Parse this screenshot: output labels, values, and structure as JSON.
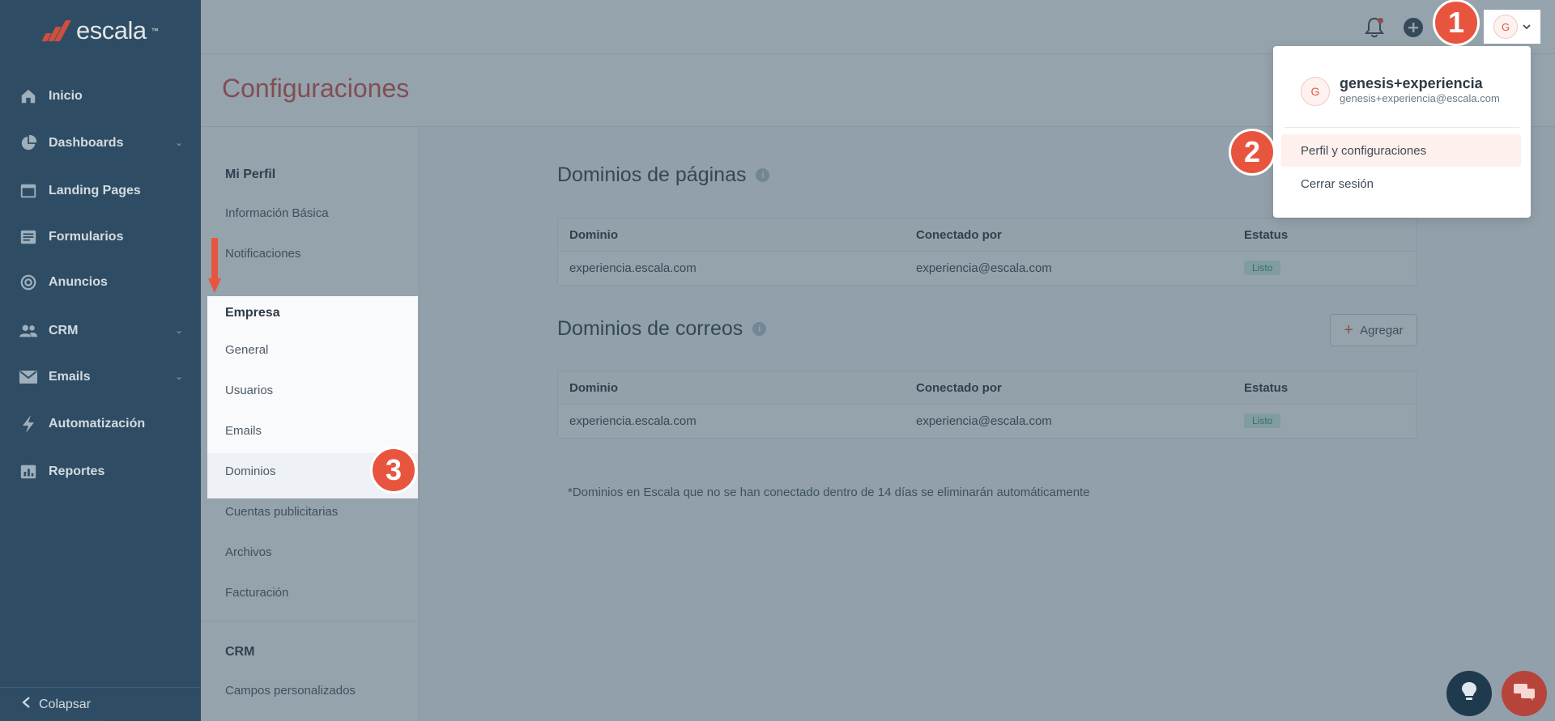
{
  "app": {
    "logo_text": "escala"
  },
  "sidebar": {
    "items": [
      {
        "label": "Inicio",
        "icon": "home-icon",
        "chevron": false
      },
      {
        "label": "Dashboards",
        "icon": "pie-chart-icon",
        "chevron": true
      },
      {
        "label": "Landing Pages",
        "icon": "browser-window-icon",
        "chevron": false
      },
      {
        "label": "Formularios",
        "icon": "form-icon",
        "chevron": false
      },
      {
        "label": "Anuncios",
        "icon": "target-icon",
        "chevron": false
      },
      {
        "label": "CRM",
        "icon": "users-icon",
        "chevron": true
      },
      {
        "label": "Emails",
        "icon": "envelope-icon",
        "chevron": true
      },
      {
        "label": "Automatización",
        "icon": "lightning-icon",
        "chevron": false
      },
      {
        "label": "Reportes",
        "icon": "bar-chart-icon",
        "chevron": false
      }
    ],
    "collapse_label": "Colapsar"
  },
  "topbar": {
    "avatar_initial": "G"
  },
  "page": {
    "title": "Configuraciones"
  },
  "settings_menu": {
    "mi_perfil": {
      "heading": "Mi Perfil",
      "items": [
        "Información Básica",
        "Notificaciones"
      ]
    },
    "empresa": {
      "heading": "Empresa",
      "items": [
        "General",
        "Usuarios",
        "Emails",
        "Dominios"
      ],
      "active": "Dominios"
    },
    "after_items": [
      "Cuentas publicitarias",
      "Archivos",
      "Facturación"
    ],
    "crm": {
      "heading": "CRM",
      "items": [
        "Campos personalizados"
      ]
    }
  },
  "domains_pages": {
    "title": "Dominios de páginas",
    "columns": [
      "Dominio",
      "Conectado por",
      "Estatus"
    ],
    "rows": [
      {
        "domain": "experiencia.escala.com",
        "connected_by": "experiencia@escala.com",
        "status": "Listo"
      }
    ]
  },
  "domains_emails": {
    "title": "Dominios de correos",
    "add_label": "Agregar",
    "columns": [
      "Dominio",
      "Conectado por",
      "Estatus"
    ],
    "rows": [
      {
        "domain": "experiencia.escala.com",
        "connected_by": "experiencia@escala.com",
        "status": "Listo"
      }
    ]
  },
  "note": "*Dominios en Escala que no se han conectado dentro de 14 días se eliminarán automáticamente",
  "user_menu": {
    "initial": "G",
    "name": "genesis+experiencia",
    "email": "genesis+experiencia@escala.com",
    "items": [
      "Perfil y configuraciones",
      "Cerrar sesión"
    ]
  },
  "steps": [
    "1",
    "2",
    "3"
  ],
  "colors": {
    "accent": "#e8553f",
    "sidebar": "#33536a",
    "title": "#d9534f"
  }
}
